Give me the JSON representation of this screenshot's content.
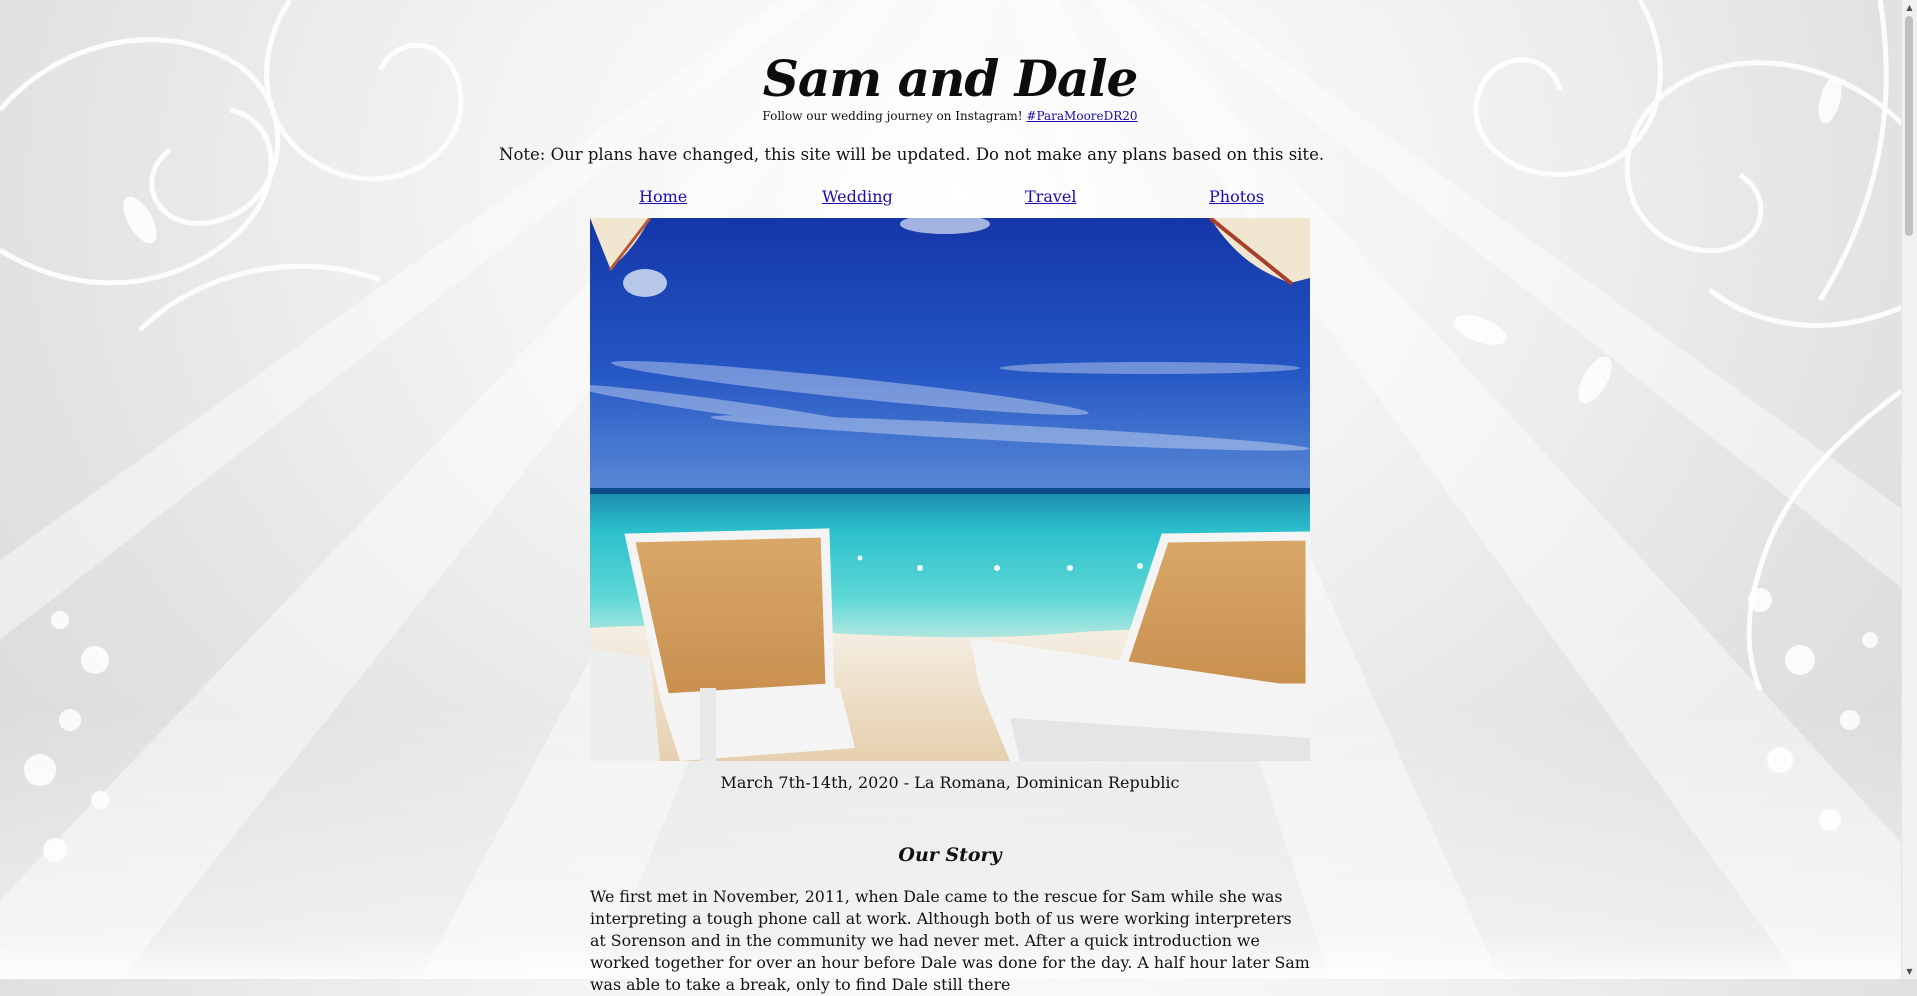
{
  "header": {
    "title": "Sam and Dale",
    "tagline_text": "Follow our wedding journey on Instagram!",
    "tagline_link": "#ParaMooreDR20"
  },
  "notice": "Note: Our plans have changed, this site will be updated. Do not make any plans based on this site.",
  "nav": {
    "items": [
      {
        "label": "Home"
      },
      {
        "label": "Wedding"
      },
      {
        "label": "Travel"
      },
      {
        "label": "Photos"
      }
    ]
  },
  "hero": {
    "caption": "March 7th-14th, 2020 - La Romana, Dominican Republic"
  },
  "story": {
    "heading": "Our Story",
    "body": "We first met in November, 2011, when Dale came to the rescue for Sam while she was interpreting a tough phone call at work. Although both of us were working interpreters at Sorenson and in the community we had never met. After a quick introduction we worked together for over an hour before Dale was done for the day. A half hour later Sam was able to take a break, only to find Dale still there"
  },
  "colors": {
    "link": "#1a0dab",
    "sky": "#1f47b8",
    "sea": "#2ec4c9",
    "sand": "#f0e6d2"
  }
}
